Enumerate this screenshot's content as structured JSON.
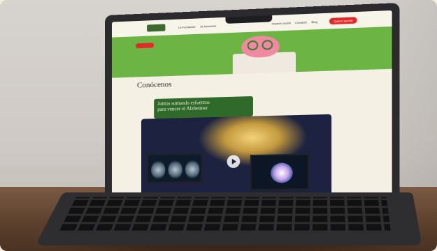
{
  "site": {
    "nav": {
      "links": [
        "La Fundación",
        "El Alzheimer"
      ],
      "links_right": [
        "Impacto social",
        "Contacto",
        "Blog"
      ],
      "donate_label": "Quiero ayudar"
    },
    "section_title": "Conócenos",
    "banner": {
      "line1": "Juntos sumando esfuerzos",
      "line2": "para vencer el Alzheimer"
    },
    "video": {
      "play_icon": "play-icon"
    }
  },
  "colors": {
    "hero_green": "#6cb544",
    "banner_green": "#2f6a2b",
    "accent_red": "#e12a2a",
    "page_bg": "#f4f0e4"
  }
}
